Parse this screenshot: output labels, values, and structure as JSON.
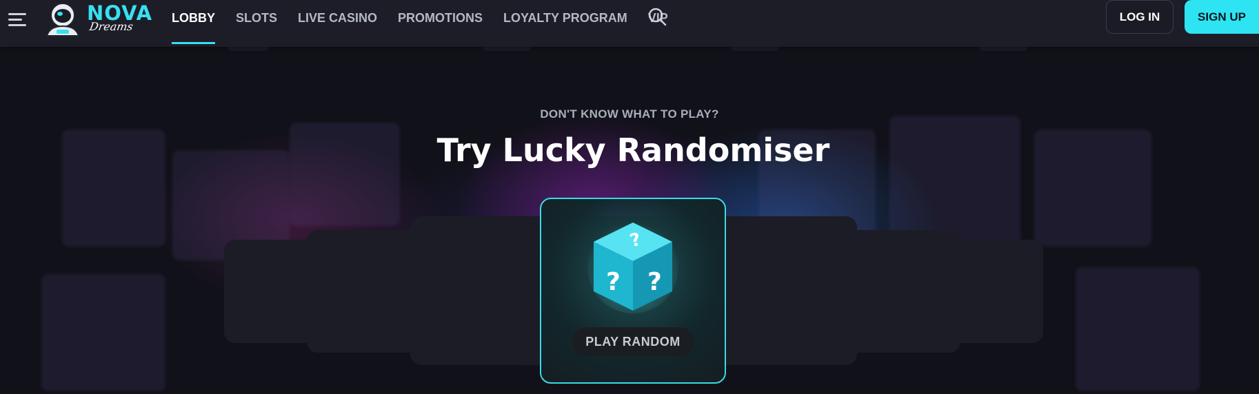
{
  "brand": {
    "name": "NOVA",
    "tagline": "Dreams",
    "accent": "#39dff0"
  },
  "header": {
    "menu_icon": "hamburger-menu-icon",
    "search_icon": "search-icon",
    "nav": [
      {
        "label": "LOBBY",
        "active": true
      },
      {
        "label": "SLOTS",
        "active": false
      },
      {
        "label": "LIVE CASINO",
        "active": false
      },
      {
        "label": "PROMOTIONS",
        "active": false
      },
      {
        "label": "LOYALTY PROGRAM",
        "active": false
      },
      {
        "label": "VIP",
        "active": false
      }
    ],
    "login_label": "LOG IN",
    "signup_label": "SIGN UP"
  },
  "hero": {
    "kicker": "DON'T KNOW WHAT TO PLAY?",
    "title": "Try Lucky Randomiser",
    "random_card": {
      "icon": "mystery-cube-icon",
      "button_label": "PLAY RANDOM"
    }
  }
}
